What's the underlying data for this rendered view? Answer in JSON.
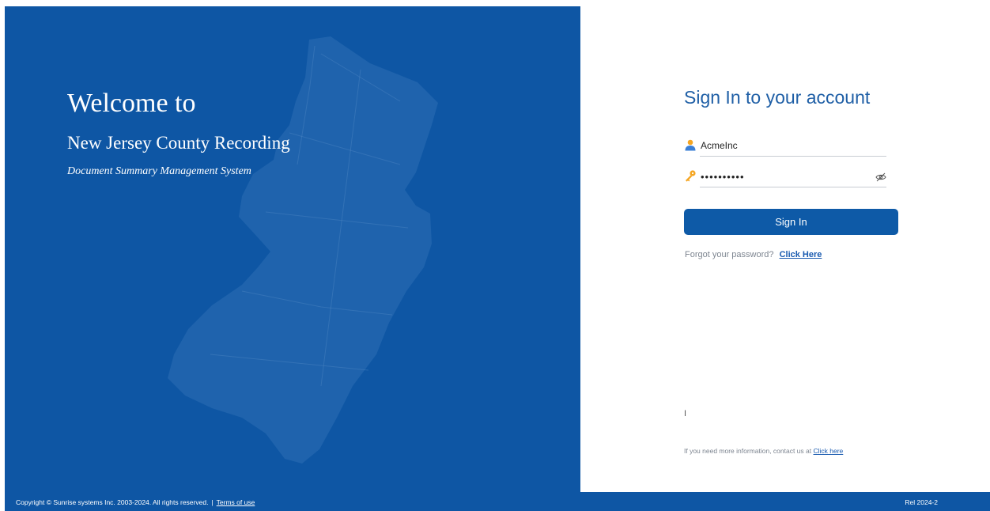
{
  "brand": {
    "welcome": "Welcome to",
    "county": "New Jersey County Recording",
    "system": "Document Summary Management System"
  },
  "login": {
    "title": "Sign In to your account",
    "username_value": "AcmeInc",
    "password_value": "••••••••••",
    "signin_label": "Sign In",
    "forgot_text": "Forgot your password?",
    "forgot_link": "Click Here"
  },
  "cursor_mark": "I",
  "contact": {
    "text": "If you need more information, contact us at",
    "link": "Click here"
  },
  "footer": {
    "copyright": "Copyright © Sunrise systems Inc. 2003-2024. All rights reserved.",
    "separator": "|",
    "terms": "Terms of use",
    "release": "Rel 2024-2"
  },
  "icons": {
    "user": "user-avatar-icon",
    "password": "key-icon",
    "toggle": "eye-slash-icon",
    "background": "new-jersey-map"
  },
  "colors": {
    "primary": "#0e56a4",
    "title": "#1f5fa6",
    "link": "#1a5bb0",
    "muted": "#7d8590"
  }
}
